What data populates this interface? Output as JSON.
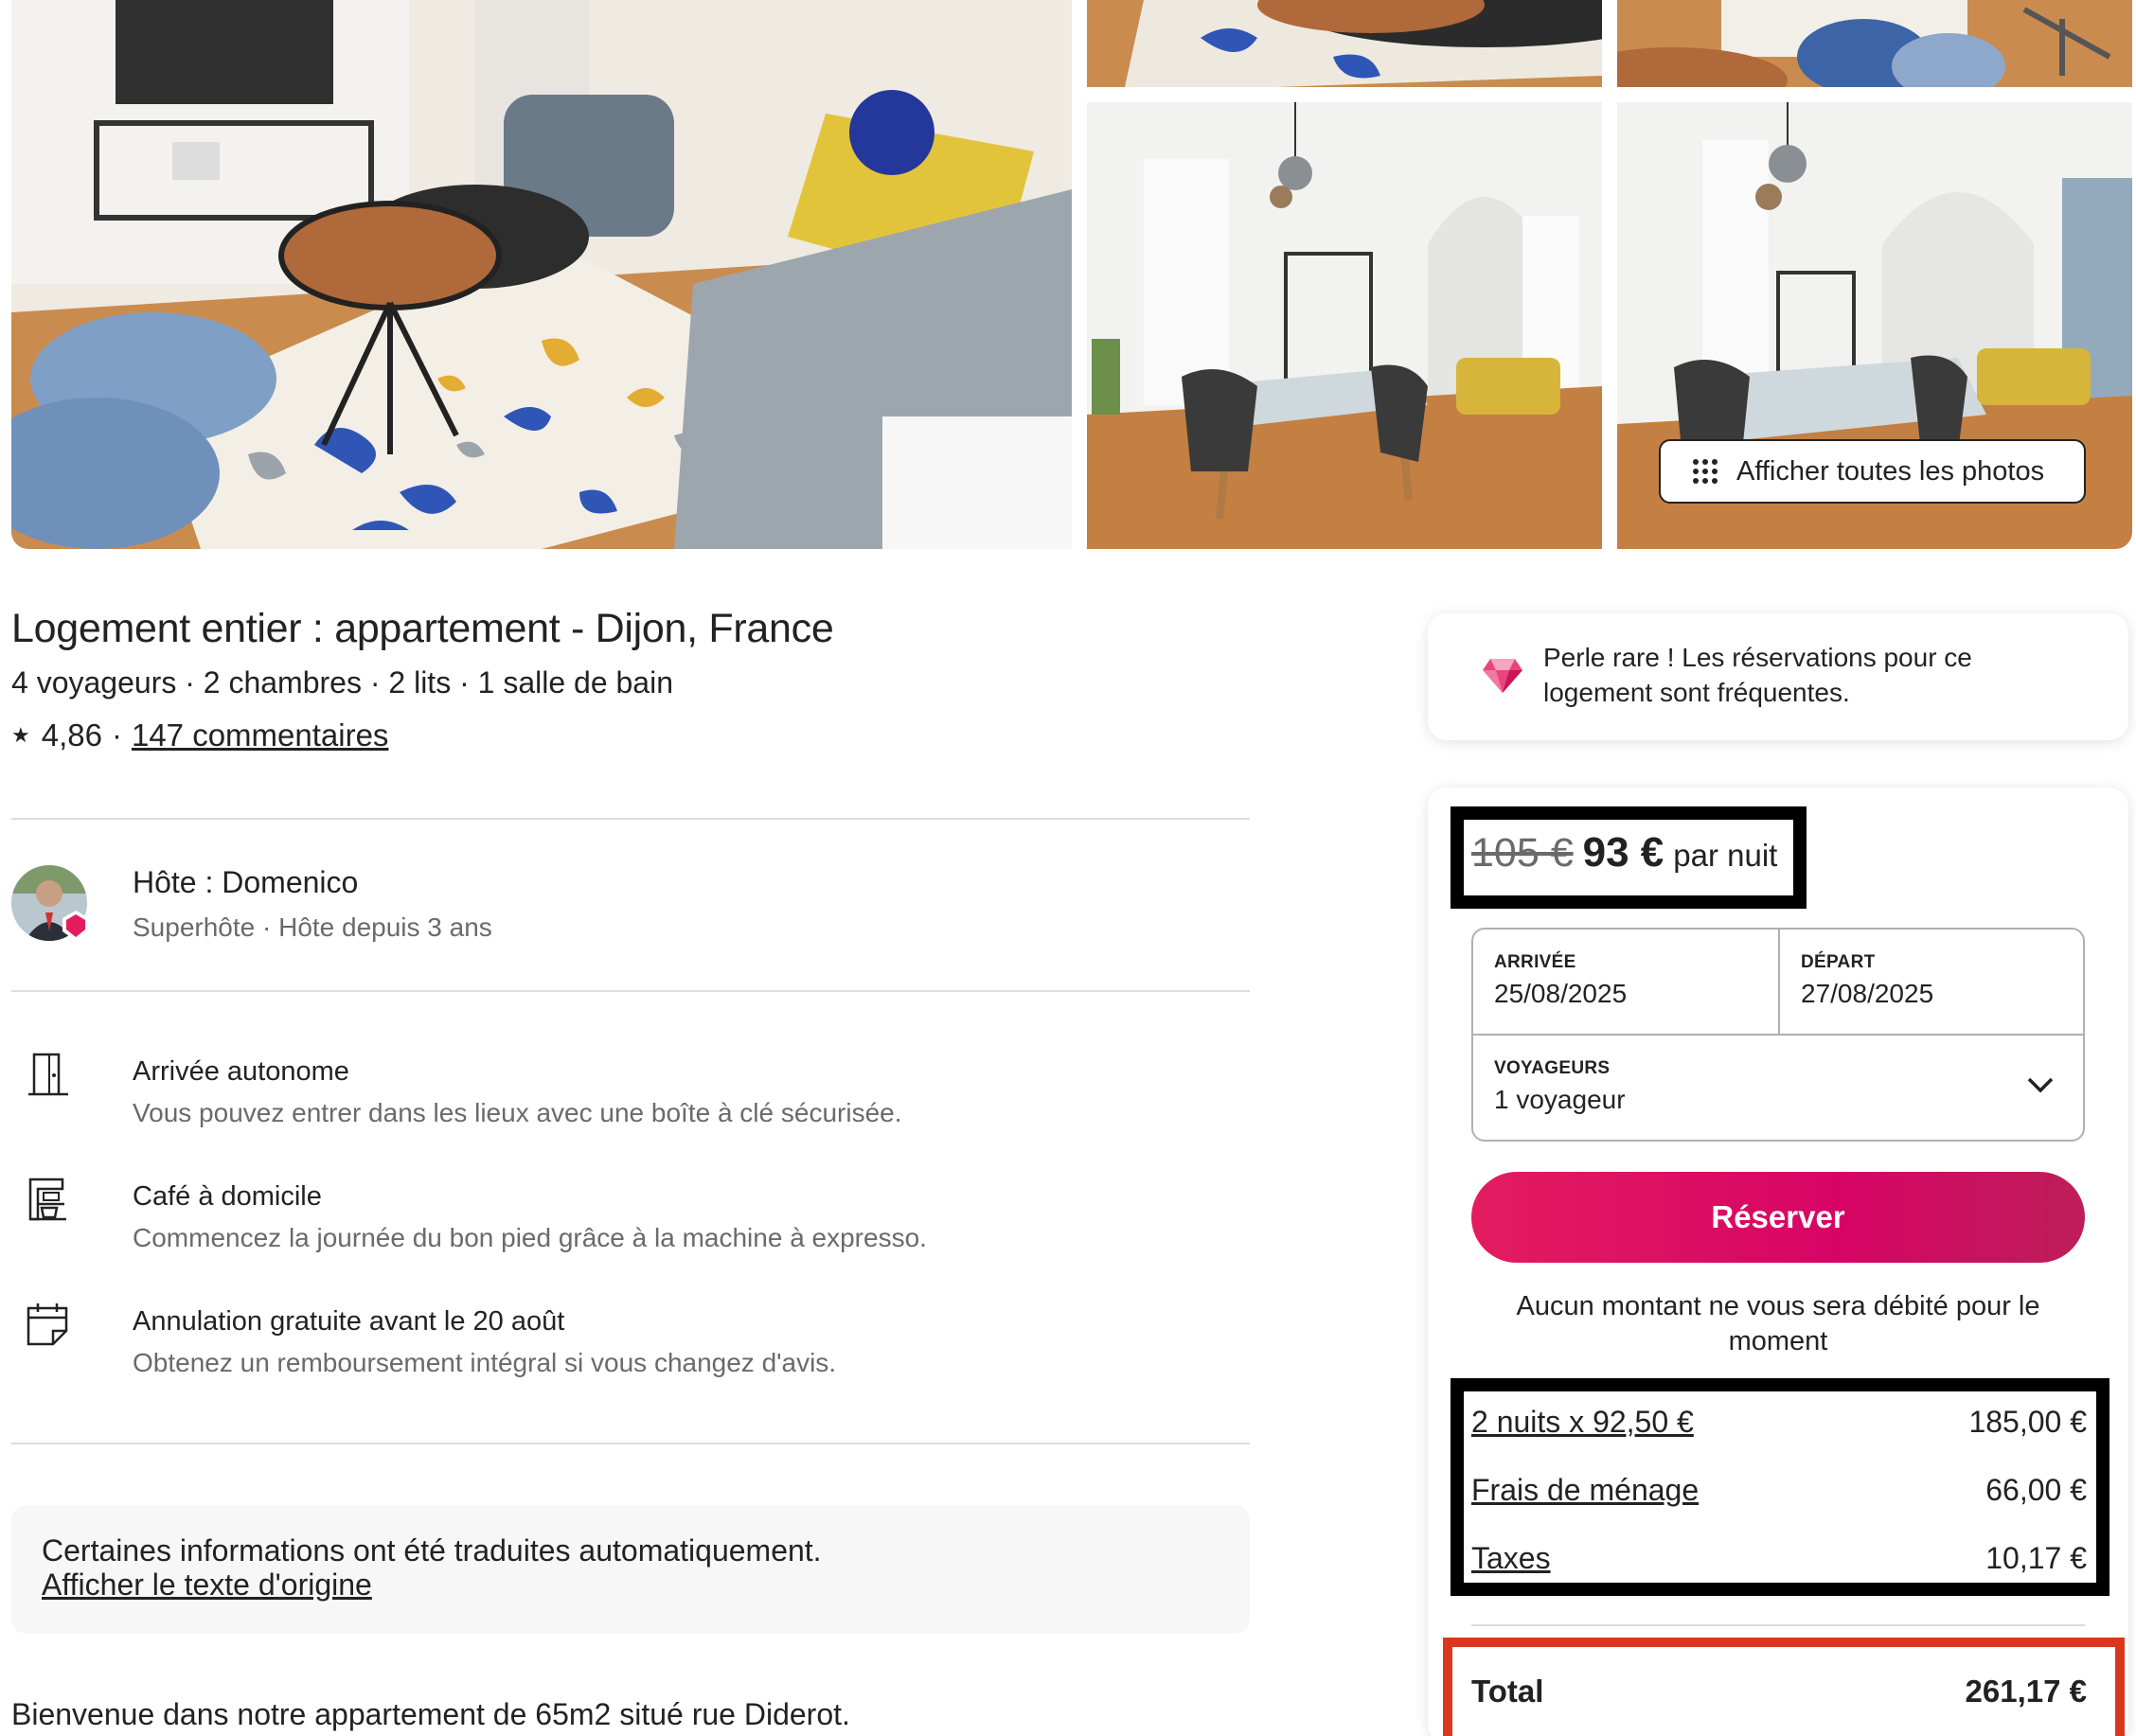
{
  "gallery": {
    "show_all_label": "Afficher toutes les photos"
  },
  "listing": {
    "title": "Logement entier : appartement - Dijon, France",
    "facts": "4 voyageurs · 2 chambres · 2 lits · 1 salle de bain",
    "rating": "4,86",
    "rating_sep": "·",
    "reviews": "147 commentaires"
  },
  "host": {
    "name": "Hôte : Domenico",
    "subtitle": "Superhôte · Hôte depuis 3 ans"
  },
  "features": [
    {
      "icon": "door-icon",
      "title": "Arrivée autonome",
      "desc": "Vous pouvez entrer dans les lieux avec une boîte à clé sécurisée."
    },
    {
      "icon": "coffee-machine-icon",
      "title": "Café à domicile",
      "desc": "Commencez la journée du bon pied grâce à la machine à expresso."
    },
    {
      "icon": "calendar-icon",
      "title": "Annulation gratuite avant le 20 août",
      "desc": "Obtenez un remboursement intégral si vous changez d'avis."
    }
  ],
  "translation": {
    "notice": "Certaines informations ont été traduites automatiquement.",
    "link": "Afficher le texte d'origine"
  },
  "description_start": "Bienvenue dans notre appartement de 65m2 situé rue Diderot.",
  "rare_find": {
    "text": "Perle rare ! Les réservations pour ce logement sont fréquentes."
  },
  "booking": {
    "old_price": "105 €",
    "price": "93 €",
    "per_night": "par nuit",
    "checkin_label": "ARRIVÉE",
    "checkin_value": "25/08/2025",
    "checkout_label": "DÉPART",
    "checkout_value": "27/08/2025",
    "guests_label": "VOYAGEURS",
    "guests_value": "1 voyageur",
    "reserve_label": "Réserver",
    "no_charge_note": "Aucun montant ne vous sera débité pour le moment",
    "fees": [
      {
        "label": "2 nuits x 92,50 €",
        "value": "185,00 €"
      },
      {
        "label": "Frais de ménage",
        "value": "66,00 €"
      },
      {
        "label": "Taxes",
        "value": "10,17 €"
      }
    ],
    "total_label": "Total",
    "total_value": "261,17 €"
  },
  "colors": {
    "brand": "#e31c5f",
    "highlight_black": "#000000",
    "highlight_red": "#d9381e"
  }
}
